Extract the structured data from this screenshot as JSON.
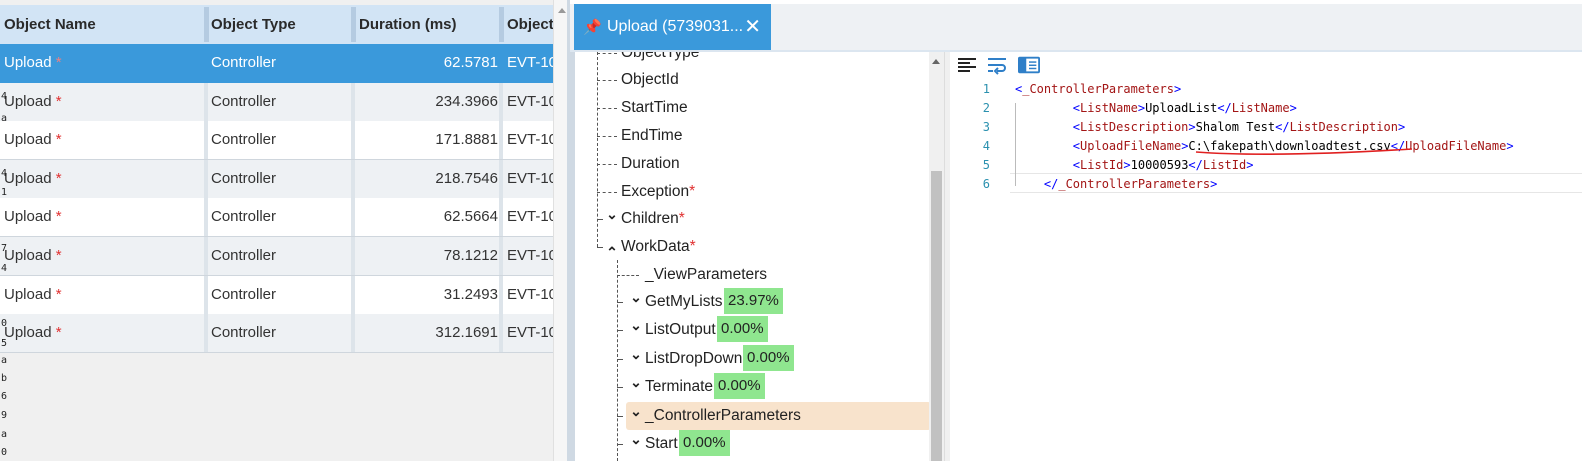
{
  "grid": {
    "columns": [
      "Object Name",
      "Object Type",
      "Duration (ms)",
      "Object"
    ],
    "rows": [
      {
        "name": "Upload",
        "required": "*",
        "type": "Controller",
        "duration": "62.5781",
        "id": "EVT-10",
        "selected": true
      },
      {
        "name": "Upload",
        "required": "*",
        "type": "Controller",
        "duration": "234.3966",
        "id": "EVT-10"
      },
      {
        "name": "Upload",
        "required": "*",
        "type": "Controller",
        "duration": "171.8881",
        "id": "EVT-10"
      },
      {
        "name": "Upload",
        "required": "*",
        "type": "Controller",
        "duration": "218.7546",
        "id": "EVT-10"
      },
      {
        "name": "Upload",
        "required": "*",
        "type": "Controller",
        "duration": "62.5664",
        "id": "EVT-10"
      },
      {
        "name": "Upload",
        "required": "*",
        "type": "Controller",
        "duration": "78.1212",
        "id": "EVT-10"
      },
      {
        "name": "Upload",
        "required": "*",
        "type": "Controller",
        "duration": "31.2493",
        "id": "EVT-10"
      },
      {
        "name": "Upload",
        "required": "*",
        "type": "Controller",
        "duration": "312.1691",
        "id": "EVT-10"
      }
    ],
    "gutter_chars": [
      "4",
      "a",
      "4",
      "1",
      "7",
      "4",
      "0",
      "5",
      "a",
      "b",
      "6",
      "9",
      "a",
      "0"
    ]
  },
  "tab": {
    "pin_icon": "📌",
    "title": "Upload (5739031...",
    "close_icon": "✕"
  },
  "tree": {
    "nodes": [
      {
        "label": "ObjectType",
        "required": "",
        "expander": "",
        "percent": ""
      },
      {
        "label": "ObjectId",
        "required": "",
        "expander": "",
        "percent": ""
      },
      {
        "label": "StartTime",
        "required": "",
        "expander": "",
        "percent": ""
      },
      {
        "label": "EndTime",
        "required": "",
        "expander": "",
        "percent": ""
      },
      {
        "label": "Duration",
        "required": "",
        "expander": "",
        "percent": ""
      },
      {
        "label": "Exception",
        "required": "*",
        "expander": "",
        "percent": ""
      },
      {
        "label": "Children",
        "required": "*",
        "expander": "collapsed",
        "percent": ""
      },
      {
        "label": "WorkData",
        "required": "*",
        "expander": "expanded",
        "percent": ""
      },
      {
        "label": "_ViewParameters",
        "required": "",
        "expander": "",
        "percent": ""
      },
      {
        "label": "GetMyLists",
        "required": "",
        "expander": "collapsed",
        "percent": "23.97%"
      },
      {
        "label": "ListOutput",
        "required": "",
        "expander": "collapsed",
        "percent": "0.00%"
      },
      {
        "label": "ListDropDown",
        "required": "",
        "expander": "collapsed",
        "percent": "0.00%"
      },
      {
        "label": "Terminate",
        "required": "",
        "expander": "collapsed",
        "percent": "0.00%"
      },
      {
        "label": "_ControllerParameters",
        "required": "",
        "expander": "collapsed",
        "percent": "",
        "highlighted": true
      },
      {
        "label": "Start",
        "required": "",
        "expander": "collapsed",
        "percent": "0.00%"
      }
    ]
  },
  "editor": {
    "toolbar": [
      "format-icon",
      "word-wrap-icon",
      "side-panel-icon"
    ],
    "lines": [
      {
        "num": "1",
        "parts": [
          [
            "br",
            "<"
          ],
          [
            "tg",
            "_ControllerParameters"
          ],
          [
            "br",
            ">"
          ]
        ]
      },
      {
        "num": "2",
        "parts": [
          [
            "sp",
            "        "
          ],
          [
            "br",
            "<"
          ],
          [
            "tg",
            "ListName"
          ],
          [
            "br",
            ">"
          ],
          [
            "tx",
            "UploadList"
          ],
          [
            "br",
            "</"
          ],
          [
            "tg",
            "ListName"
          ],
          [
            "br",
            ">"
          ]
        ]
      },
      {
        "num": "3",
        "parts": [
          [
            "sp",
            "        "
          ],
          [
            "br",
            "<"
          ],
          [
            "tg",
            "ListDescription"
          ],
          [
            "br",
            ">"
          ],
          [
            "tx",
            "Shalom Test"
          ],
          [
            "br",
            "</"
          ],
          [
            "tg",
            "ListDescription"
          ],
          [
            "br",
            ">"
          ]
        ]
      },
      {
        "num": "4",
        "parts": [
          [
            "sp",
            "        "
          ],
          [
            "br",
            "<"
          ],
          [
            "tg",
            "UploadFileName"
          ],
          [
            "br",
            ">"
          ],
          [
            "tx",
            "C:\\fakepath\\downloadtest.csv"
          ],
          [
            "br",
            "</"
          ],
          [
            "tg",
            "UploadFileName"
          ],
          [
            "br",
            ">"
          ]
        ]
      },
      {
        "num": "5",
        "parts": [
          [
            "sp",
            "        "
          ],
          [
            "br",
            "<"
          ],
          [
            "tg",
            "ListId"
          ],
          [
            "br",
            ">"
          ],
          [
            "tx",
            "10000593"
          ],
          [
            "br",
            "</"
          ],
          [
            "tg",
            "ListId"
          ],
          [
            "br",
            ">"
          ]
        ]
      },
      {
        "num": "6",
        "parts": [
          [
            "sp",
            "    "
          ],
          [
            "br",
            "</"
          ],
          [
            "tg",
            "_ControllerParameters"
          ],
          [
            "br",
            ">"
          ]
        ]
      }
    ],
    "annotation_color": "#e02020"
  },
  "colors": {
    "accent": "#3a99db",
    "header_bg": "#d2e4f5",
    "percent_badge": "#8fe68f",
    "highlight": "#f8e3cc",
    "required_star": "#e03030"
  }
}
